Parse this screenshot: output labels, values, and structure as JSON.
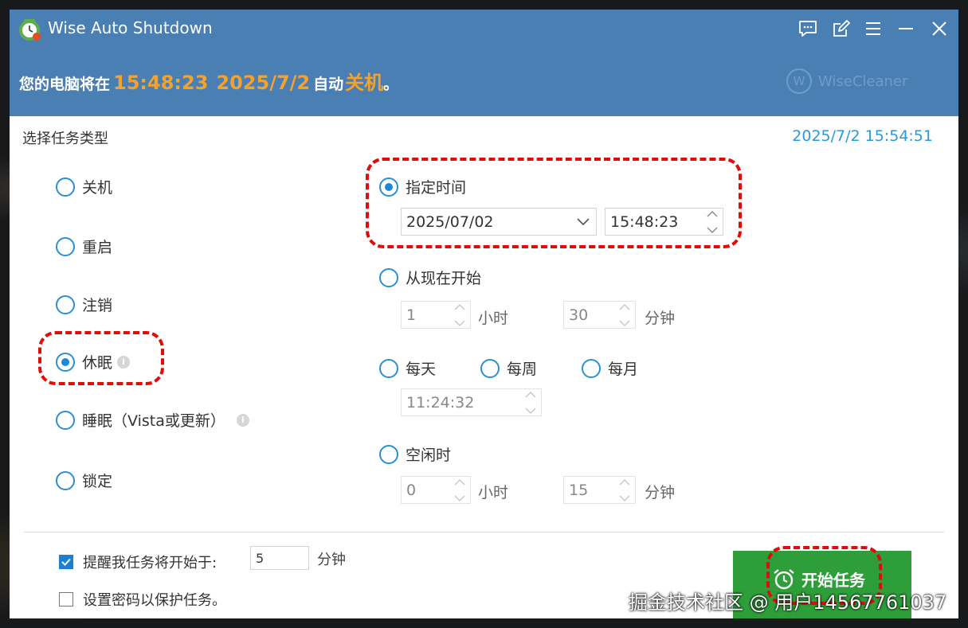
{
  "window": {
    "title": "Wise Auto Shutdown"
  },
  "status": {
    "prefix": "您的电脑将在",
    "time": "15:48:23",
    "date": "2025/7/2",
    "middle": "自动",
    "action": "关机",
    "suffix": "。"
  },
  "brand": {
    "logo_letter": "W",
    "name": "WiseCleaner"
  },
  "task_type": {
    "title": "选择任务类型",
    "current_datetime": "2025/7/2 15:54:51",
    "options": [
      {
        "label": "关机",
        "selected": false
      },
      {
        "label": "重启",
        "selected": false
      },
      {
        "label": "注销",
        "selected": false
      },
      {
        "label": "休眠",
        "selected": true
      },
      {
        "label": "睡眠（Vista或更新）",
        "selected": false
      },
      {
        "label": "锁定",
        "selected": false
      }
    ]
  },
  "schedule": {
    "specified_time": {
      "label": "指定时间",
      "selected": true,
      "date": "2025/07/02",
      "time": "15:48:23"
    },
    "from_now": {
      "label": "从现在开始",
      "selected": false,
      "hours": "1",
      "hours_unit": "小时",
      "minutes": "30",
      "minutes_unit": "分钟"
    },
    "daily": {
      "label": "每天",
      "selected": false
    },
    "weekly": {
      "label": "每周",
      "selected": false
    },
    "monthly": {
      "label": "每月",
      "selected": false
    },
    "repeat_time": "11:24:32",
    "idle": {
      "label": "空闲时",
      "selected": false,
      "hours": "0",
      "hours_unit": "小时",
      "minutes": "15",
      "minutes_unit": "分钟"
    }
  },
  "footer": {
    "remind_label": "提醒我任务将开始于:",
    "remind_checked": true,
    "remind_value": "5",
    "remind_unit": "分钟",
    "password_label": "设置密码以保护任务。",
    "password_checked": false,
    "start_button": "开始任务"
  },
  "watermark": "掘金技术社区 @ 用户14567761037",
  "colors": {
    "header": "#4a7fb4",
    "accent_orange": "#f5a12a",
    "radio_blue": "#1d8ad6",
    "start_green": "#2e9e3a",
    "annotation_red": "#e00b0b"
  }
}
